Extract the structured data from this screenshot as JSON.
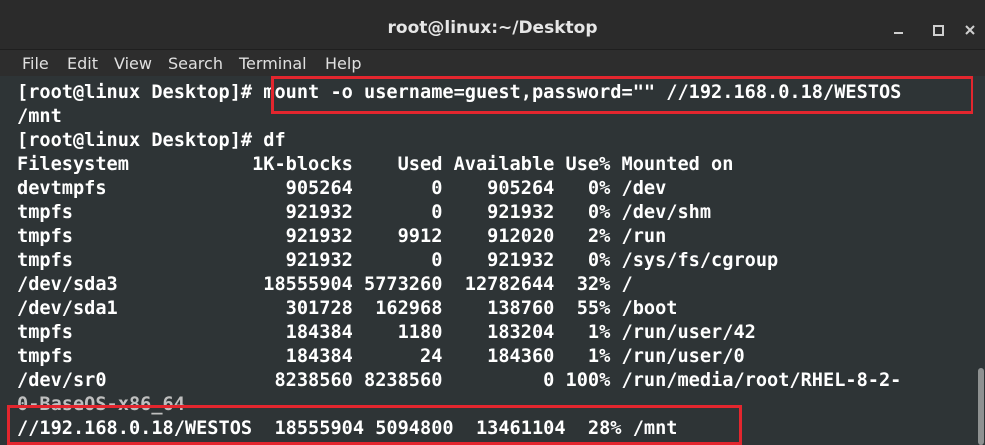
{
  "window": {
    "title": "root@linux:~/Desktop"
  },
  "menu": [
    "File",
    "Edit",
    "View",
    "Search",
    "Terminal",
    "Help"
  ],
  "terminal": {
    "lines": [
      "[root@linux Desktop]# mount -o username=guest,password=\"\" //192.168.0.18/WESTOS",
      "/mnt",
      "[root@linux Desktop]# df",
      "Filesystem           1K-blocks    Used Available Use% Mounted on",
      "devtmpfs                905264       0    905264   0% /dev",
      "tmpfs                   921932       0    921932   0% /dev/shm",
      "tmpfs                   921932    9912    912020   2% /run",
      "tmpfs                   921932       0    921932   0% /sys/fs/cgroup",
      "/dev/sda3             18555904 5773260  12782644  32% /",
      "/dev/sda1               301728  162968    138760  55% /boot",
      "tmpfs                   184384    1180    183204   1% /run/user/42",
      "tmpfs                   184384      24    184360   1% /run/user/0",
      "/dev/sr0               8238560 8238560         0 100% /run/media/root/RHEL-8-2-",
      "0-BaseOS-x86_64",
      "//192.168.0.18/WESTOS  18555904 5094800  13461104  28% /mnt"
    ]
  },
  "colors": {
    "terminal_bg": "#2e3436",
    "text": "#ffffff",
    "highlight": "#e3262e",
    "titlebar_bg": "#2b2b2b"
  }
}
